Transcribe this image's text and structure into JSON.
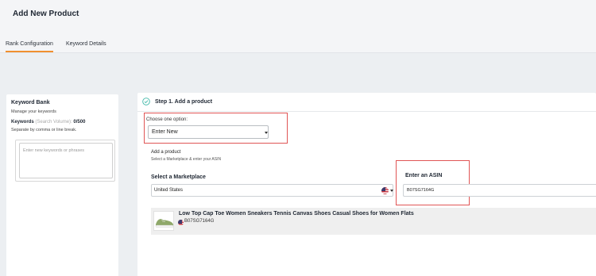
{
  "header": {
    "title": "Add New Product"
  },
  "tabs": [
    {
      "label": "Rank Configuration",
      "active": true
    },
    {
      "label": "Keyword Details",
      "active": false
    }
  ],
  "keyword_bank": {
    "title": "Keyword Bank",
    "subtitle": "Manage your keywords",
    "keywords_label": "Keywords",
    "search_volume_hint": "(Search Volume):",
    "count": "0/500",
    "separator_hint": "Separate by comma or line break.",
    "placeholder": "Enter new keywords or phrases"
  },
  "step": {
    "title": "Step 1. Add a product",
    "choose_label": "Choose one option:",
    "choose_value": "Enter New",
    "add_title": "Add a product",
    "add_subtitle": "Select a Marketplace & enter your ASIN",
    "marketplace_label": "Select a Marketplace",
    "marketplace_value": "United States",
    "asin_label": "Enter an ASIN",
    "asin_value": "B07SG7164G"
  },
  "product": {
    "title": "Low Top Cap Toe Women Sneakers Tennis Canvas Shoes Casual Shoes for Women Flats",
    "asin": "B07SG7164G"
  },
  "colors": {
    "accent": "#f0902f",
    "highlight_border": "#e05555"
  }
}
